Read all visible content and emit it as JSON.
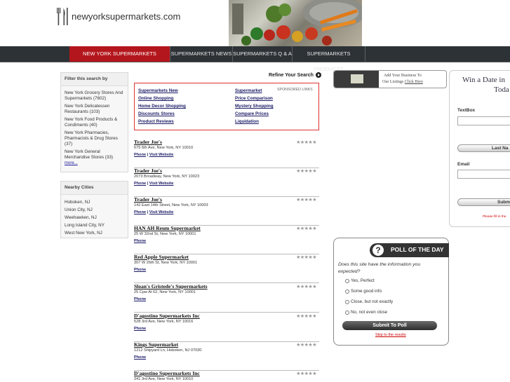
{
  "header": {
    "site_name": "newyorksupermarkets.com"
  },
  "nav": {
    "items": [
      {
        "label": "NEW YORK SUPERMARKETS DIRECTORY"
      },
      {
        "label": "SUPERMARKETS NEWS"
      },
      {
        "label": "SUPERMARKETS Q & A"
      },
      {
        "label": "SUPERMARKETS PRODUCTS"
      }
    ]
  },
  "filter": {
    "title": "Filter this search by",
    "items": [
      "New York Grocery Stores And Supermarkets (7602)",
      "New York Delicatessen Restaurants (103)",
      "New York Food Products & Condiments (40)",
      "New York Pharmacies, Pharmacists & Drug Stores (37)",
      "New York General Merchandise Stores (33)"
    ],
    "more": "more..."
  },
  "nearby": {
    "title": "Nearby Cities",
    "items": [
      "Hoboken, NJ",
      "Union City, NJ",
      "Weehawken, NJ",
      "Long Island City, NY",
      "West New York, NJ"
    ]
  },
  "refine": {
    "label": "Refine Your Search"
  },
  "sponsored": {
    "tag": "SPONSORED LINKS",
    "left": [
      "Supermarkets New",
      "Online Shopping",
      "Home Decor Shopping",
      "Discounts Stores",
      "Product Reviews"
    ],
    "right": [
      "Supermarket",
      "Price Comparison",
      "Mystery Shopping",
      "Compare Prices",
      "Liquidation"
    ]
  },
  "listings": [
    {
      "name": "Trader Joe's",
      "address": "675 6th Ave, New York, NY 10010",
      "phone": "Phone",
      "website": "Visit Website",
      "stars": "★★★★★"
    },
    {
      "name": "Trader Joe's",
      "address": "2073 Broadway, New York, NY 10023",
      "phone": "Phone",
      "website": "Visit Website",
      "stars": "★★★★★"
    },
    {
      "name": "Trader Joe's",
      "address": "142 East 14th Street, New York, NY 10003",
      "phone": "Phone",
      "website": "Visit Website",
      "stars": "★★★★★"
    },
    {
      "name": "HAN AH Reum Supermarket",
      "address": "25 W 32nd St, New York, NY 10001",
      "phone": "Phone",
      "website": "",
      "stars": "★★★★★"
    },
    {
      "name": "Red Apple Supermarket",
      "address": "307 W 26th St, New York, NY 10001",
      "phone": "Phone",
      "website": "",
      "stars": "★★★★★"
    },
    {
      "name": "Sloan's Gristede's Supermarkets",
      "address": "25 Cpw At 62, New York, NY 10001",
      "phone": "Phone",
      "website": "",
      "stars": "★★★★★"
    },
    {
      "name": "D'agostino Supermarkets Inc",
      "address": "528 3rd Ave, New York, NY 10016",
      "phone": "Phone",
      "website": "",
      "stars": "★★★★★"
    },
    {
      "name": "Kings Supermarket",
      "address": "1212 Shipyard Ln, Hoboken, NJ 07030",
      "phone": "Phone",
      "website": "",
      "stars": "★★★★★"
    },
    {
      "name": "D'agostino Supermarkets Inc",
      "address": "341 3rd Ave, New York, NY 10010",
      "phone": "Phone",
      "website": "",
      "stars": "★★★★★"
    }
  ],
  "addbiz": {
    "line1": "Add Your Business To",
    "line2": "Our Listings",
    "link": "Click Here"
  },
  "win": {
    "title_line1": "Win a Date in",
    "title_line2": "Toda",
    "textbox_label": "TextBox",
    "lastname_button": "Last Na",
    "email_label": "Email",
    "submit_button": "Subm",
    "note": "Please fill in the"
  },
  "poll": {
    "title": "POLL OF THE DAY",
    "question": "Does this site have the information you expected?",
    "options": [
      "Yes, Perfect",
      "Some good info",
      "Close, but not exactly",
      "No, not even close"
    ],
    "submit": "Submit To Poll",
    "skip": "Skip to the results"
  },
  "colors": {
    "nav_bg": "#2d3236",
    "nav_active": "#b3161c",
    "sponsored_border": "#dd3333",
    "link": "#1a1a66"
  }
}
